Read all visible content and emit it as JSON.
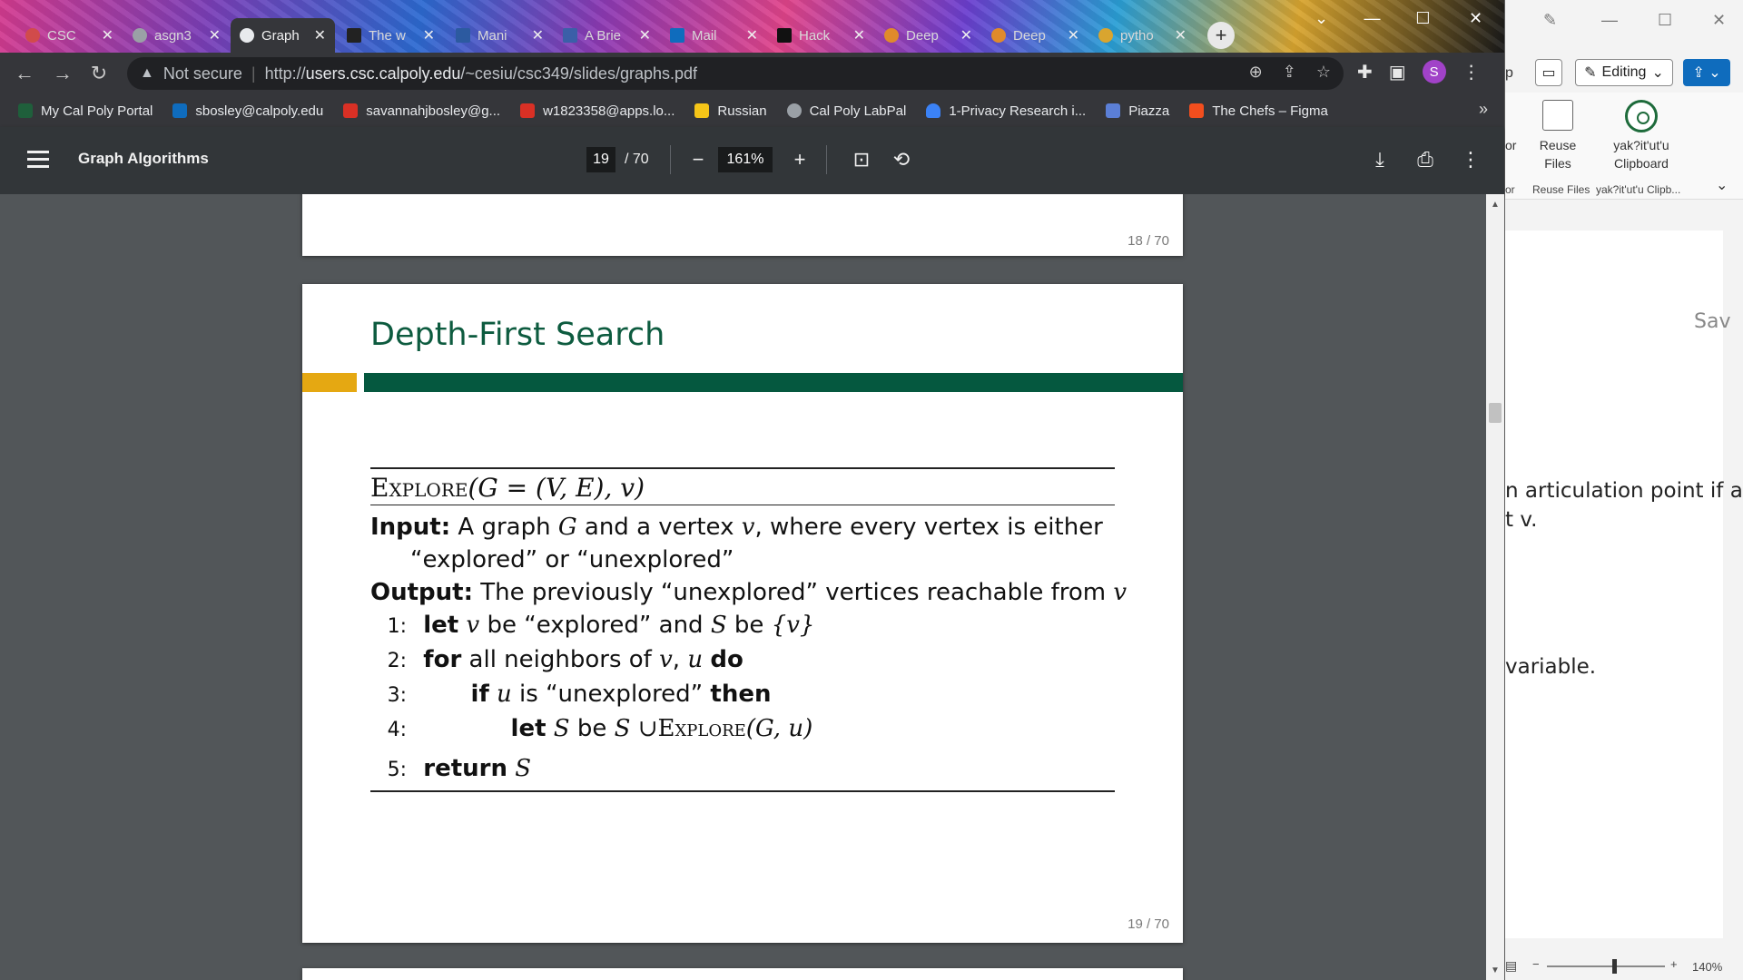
{
  "browser": {
    "tabs": [
      {
        "title": "CSC"
      },
      {
        "title": "asgn3"
      },
      {
        "title": "Graph"
      },
      {
        "title": "The w"
      },
      {
        "title": "Mani"
      },
      {
        "title": "A Brie"
      },
      {
        "title": "Mail"
      },
      {
        "title": "Hack"
      },
      {
        "title": "Deep"
      },
      {
        "title": "Deep"
      },
      {
        "title": "pytho"
      }
    ],
    "address": {
      "security_label": "Not secure",
      "url_host": "users.csc.calpoly.edu",
      "url_path": "/~cesiu/csc349/slides/graphs.pdf",
      "scheme": "http://"
    },
    "profile_initial": "S",
    "bookmarks": [
      {
        "label": "My Cal Poly Portal",
        "color": "#1f5f3b"
      },
      {
        "label": "sbosley@calpoly.edu",
        "color": "#0f6cbd"
      },
      {
        "label": "savannahjbosley@g...",
        "color": "#d93025"
      },
      {
        "label": "w1823358@apps.lo...",
        "color": "#d93025"
      },
      {
        "label": "Russian",
        "color": "#f5c518"
      },
      {
        "label": "Cal Poly LabPal",
        "color": "#9aa0a6"
      },
      {
        "label": "1-Privacy Research i...",
        "color": "#3b82f6"
      },
      {
        "label": "Piazza",
        "color": "#5b7fd6"
      },
      {
        "label": "The Chefs – Figma",
        "color": "#f24e1e"
      }
    ]
  },
  "pdf_toolbar": {
    "title": "Graph Algorithms",
    "page_current": "19",
    "page_total": "/ 70",
    "zoom": "161%"
  },
  "pdf": {
    "prev_page_number": "18 / 70",
    "current_page_number": "19 / 70",
    "slide_title": "Depth-First Search",
    "algorithm": {
      "name": "Explore",
      "signature": "(G = (V, E), v)",
      "input_label": "Input:",
      "input_text_1": "A graph",
      "input_var_g": "G",
      "input_text_2": "and a vertex",
      "input_var_v": "v",
      "input_text_3": ", where every vertex is either",
      "input_text_4": "“explored” or “unexplored”",
      "output_label": "Output:",
      "output_text": "The previously “unexplored” vertices reachable from",
      "output_var": "v",
      "lines": [
        {
          "num": "1:",
          "kw": "let",
          "a": "v",
          "b": "be “explored” and",
          "c": "S",
          "d": "be",
          "e": "{v}"
        },
        {
          "num": "2:",
          "kw": "for",
          "a": "all neighbors of",
          "b": "v",
          "c": ",",
          "d": "u",
          "kw2": "do"
        },
        {
          "num": "3:",
          "kw": "if",
          "a": "u",
          "b": "is “unexplored”",
          "kw2": "then"
        },
        {
          "num": "4:",
          "kw": "let",
          "a": "S",
          "b": "be",
          "c": "S ∪",
          "d": "Explore",
          "e": "(G, u)"
        },
        {
          "num": "5:",
          "kw": "return",
          "a": "S"
        }
      ]
    }
  },
  "word": {
    "editing_label": "Editing",
    "reuse_files_label": "Reuse Files",
    "clipboard_label": "yak?it'ut'u Clipboard",
    "group_reuse": "Reuse Files",
    "group_clip": "yak?it'ut'u Clipb...",
    "group_partial": "or",
    "ribbon_partial_1": "p",
    "ribbon_partial_2": "or",
    "save_partial": "Sav",
    "doc_line_1": "n articulation point if a",
    "doc_line_2": "t v.",
    "doc_line_3": "variable.",
    "zoom": "140%"
  }
}
